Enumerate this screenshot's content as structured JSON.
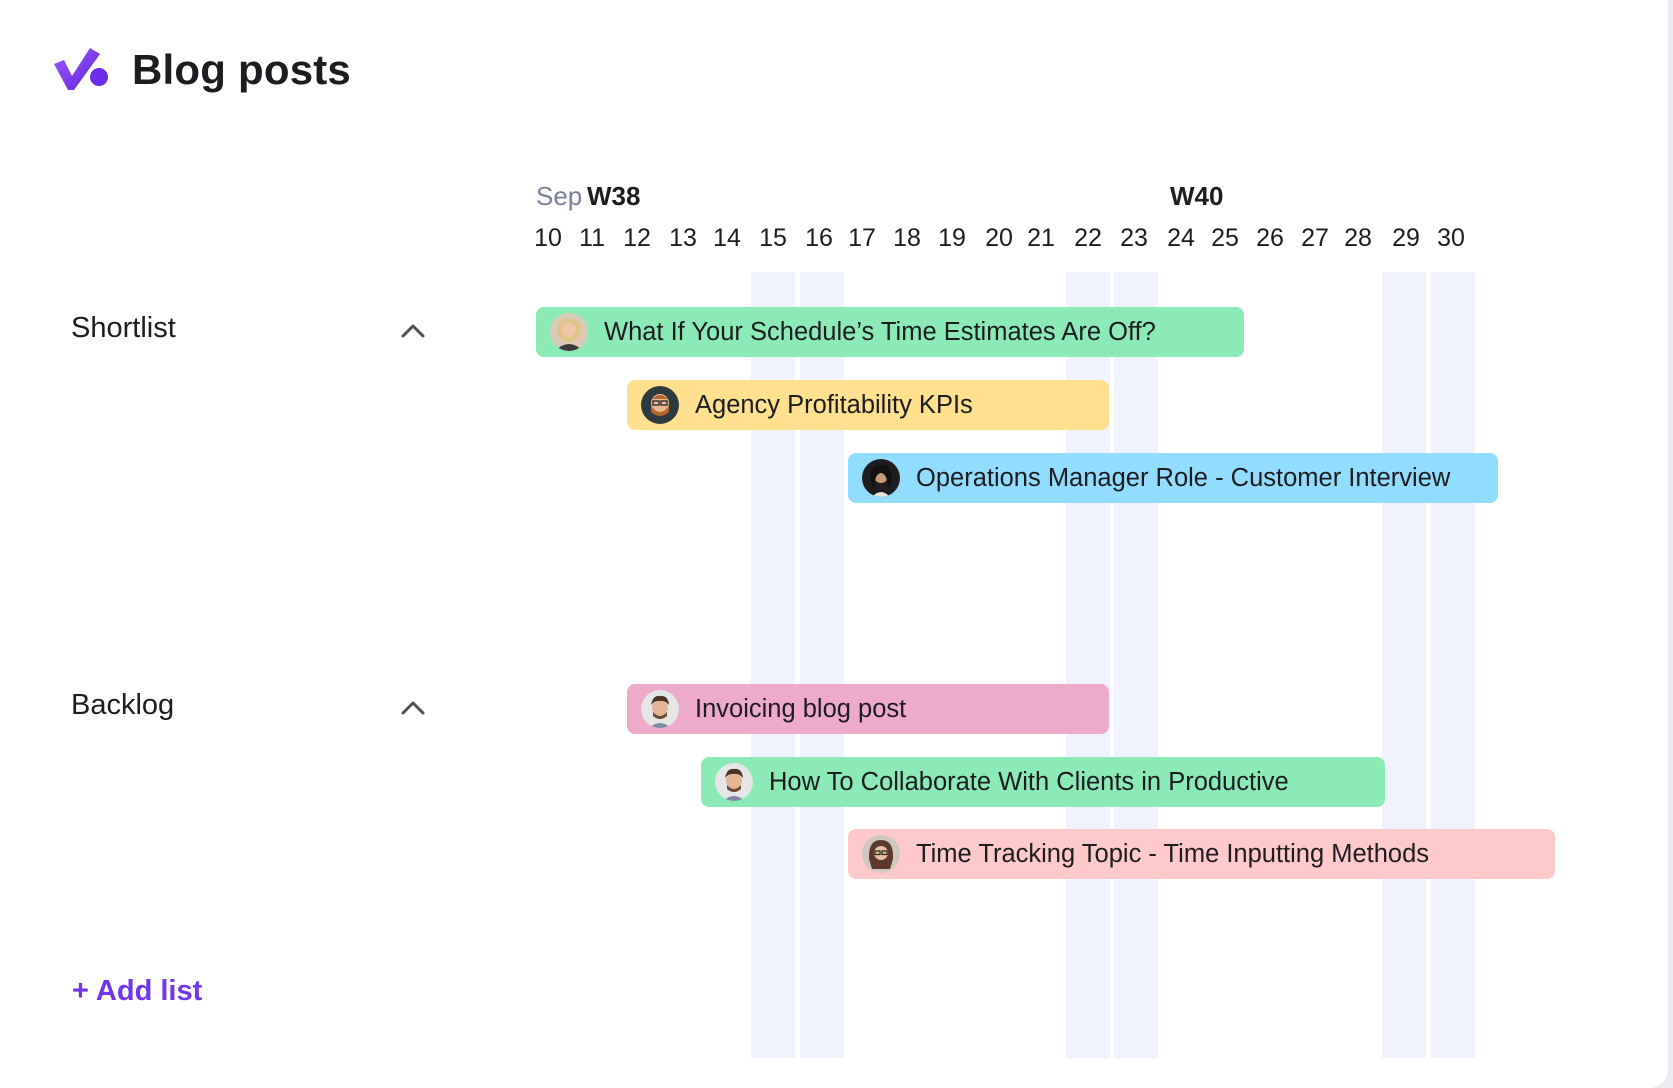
{
  "app": {
    "title": "Blog posts",
    "logo_icon": "checkmark-logo-icon",
    "accent": "#7135f0"
  },
  "timeline": {
    "month": "Sep",
    "weeks": [
      {
        "label": "W38"
      },
      {
        "label": "W40"
      }
    ],
    "days": [
      "10",
      "11",
      "12",
      "13",
      "14",
      "15",
      "16",
      "17",
      "18",
      "19",
      "20",
      "21",
      "22",
      "23",
      "24",
      "25",
      "26",
      "27",
      "28",
      "29",
      "30"
    ],
    "weekend_days": [
      "15",
      "16",
      "22",
      "23",
      "29",
      "30"
    ]
  },
  "groups": [
    {
      "label": "Shortlist",
      "toggle_icon": "chevron-up-icon",
      "tasks": [
        {
          "title": "What If Your Schedule’s Time Estimates Are Off?",
          "color": "#8ceab6",
          "avatar": "avatar-blonde-woman"
        },
        {
          "title": "Agency Profitability KPIs",
          "color": "#fee08f",
          "avatar": "avatar-bearded-man-glasses"
        },
        {
          "title": "Operations Manager Role - Customer Interview",
          "color": "#92dcfd",
          "avatar": "avatar-dark-hair-woman"
        }
      ]
    },
    {
      "label": "Backlog",
      "toggle_icon": "chevron-up-icon",
      "tasks": [
        {
          "title": "Invoicing blog post",
          "color": "#eeaaca",
          "avatar": "avatar-curly-man"
        },
        {
          "title": "How To Collaborate With Clients in Productive",
          "color": "#8ceab6",
          "avatar": "avatar-curly-man"
        },
        {
          "title": "Time Tracking Topic - Time Inputting Methods",
          "color": "#fec9ca",
          "avatar": "avatar-woman-glasses"
        }
      ]
    }
  ],
  "add_list_label": "+ Add list"
}
